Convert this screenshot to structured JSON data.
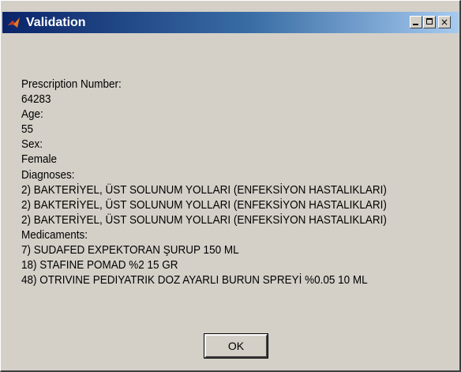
{
  "window": {
    "title": "Validation",
    "minimize": "_",
    "maximize": "□",
    "close": "×"
  },
  "labels": {
    "prescription_number": "Prescription Number:",
    "age": "Age:",
    "sex": "Sex:",
    "diagnoses": "Diagnoses:",
    "medicaments": "Medicaments:"
  },
  "values": {
    "prescription_number": "64283",
    "age": "55",
    "sex": "Female"
  },
  "diagnoses": [
    "2) BAKTERİYEL, ÜST SOLUNUM YOLLARI  (ENFEKSİYON HASTALIKLARI)",
    "2) BAKTERİYEL, ÜST SOLUNUM YOLLARI  (ENFEKSİYON HASTALIKLARI)",
    "2) BAKTERİYEL, ÜST SOLUNUM YOLLARI  (ENFEKSİYON HASTALIKLARI)"
  ],
  "medicaments": [
    "7) SUDAFED EXPEKTORAN ŞURUP 150 ML",
    "18) STAFINE POMAD %2 15 GR",
    "48) OTRIVINE PEDIYATRIK DOZ AYARLI BURUN SPREYİ %0.05 10 ML"
  ],
  "ok_label": "OK"
}
